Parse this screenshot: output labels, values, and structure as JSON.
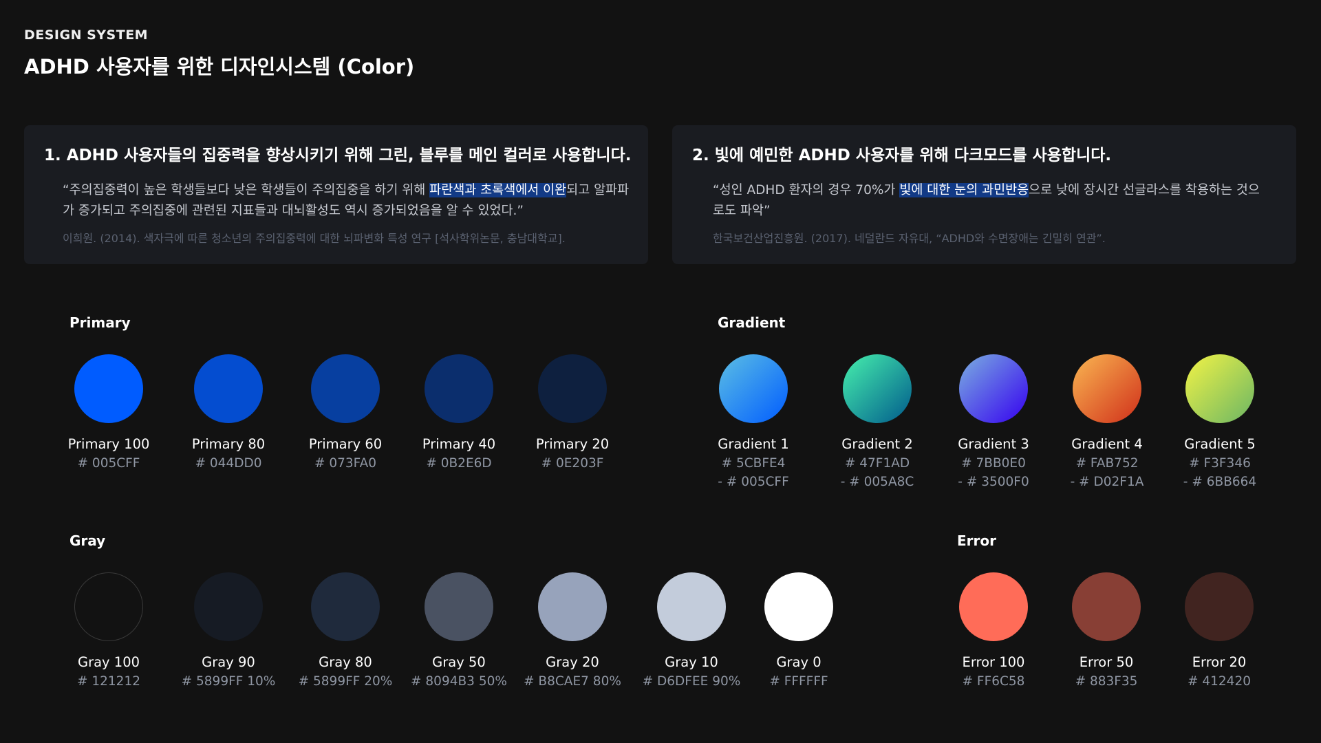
{
  "header": {
    "eyebrow": "DESIGN SYSTEM",
    "title": "ADHD 사용자를 위한 디자인시스템 (Color)"
  },
  "principles": [
    {
      "title": "1. ADHD 사용자들의 집중력을 향상시키기 위해 그린, 블루를 메인 컬러로 사용합니다.",
      "quote_before": "“주의집중력이 높은 학생들보다 낮은 학생들이 주의집중을 하기 위해 ",
      "quote_highlight": "파란색과 초록색에서 이완",
      "quote_after": "되고 알파파가 증가되고 주의집중에 관련된 지표들과 대뇌활성도 역시 증가되었음을 알 수 있었다.”",
      "source": "이희원. (2014). 색자극에 따른 청소년의 주의집중력에 대한 뇌파변화 특성 연구 [석사학위논문, 충남대학교]."
    },
    {
      "title": "2. 빛에 예민한 ADHD 사용자를 위해 다크모드를 사용합니다.",
      "quote_before": "“성인 ADHD 환자의 경우 70%가 ",
      "quote_highlight": "빛에 대한 눈의 과민반응",
      "quote_after": "으로 낮에 장시간 선글라스를 착용하는 것으로도 파악”",
      "source": "한국보건산업진흥원. (2017). 네덜란드 자유대, “ADHD와 수면장애는 긴밀히 연관”."
    }
  ],
  "primary": {
    "label": "Primary",
    "swatches": [
      {
        "name": "Primary 100",
        "hex": "# 005CFF",
        "color": "#005CFF"
      },
      {
        "name": "Primary 80",
        "hex": "# 044DD0",
        "color": "#044DD0"
      },
      {
        "name": "Primary 60",
        "hex": "# 073FA0",
        "color": "#073FA0"
      },
      {
        "name": "Primary 40",
        "hex": "# 0B2E6D",
        "color": "#0B2E6D"
      },
      {
        "name": "Primary 20",
        "hex": "# 0E203F",
        "color": "#0E203F"
      }
    ]
  },
  "gradient": {
    "label": "Gradient",
    "swatches": [
      {
        "name": "Gradient 1",
        "hex": "# 5CBFE4",
        "hex2": "- # 005CFF",
        "from": "#5CBFE4",
        "to": "#005CFF"
      },
      {
        "name": "Gradient 2",
        "hex": "# 47F1AD",
        "hex2": "- # 005A8C",
        "from": "#47F1AD",
        "to": "#005A8C"
      },
      {
        "name": "Gradient 3",
        "hex": "# 7BB0E0",
        "hex2": "- # 3500F0",
        "from": "#7BB0E0",
        "to": "#3500F0"
      },
      {
        "name": "Gradient 4",
        "hex": "# FAB752",
        "hex2": "- # D02F1A",
        "from": "#FAB752",
        "to": "#D02F1A"
      },
      {
        "name": "Gradient 5",
        "hex": "# F3F346",
        "hex2": "- # 6BB664",
        "from": "#F3F346",
        "to": "#6BB664"
      }
    ]
  },
  "gray": {
    "label": "Gray",
    "swatches": [
      {
        "name": "Gray 100",
        "hex": "# 121212",
        "color": "#121212",
        "border": "#3a3a3a"
      },
      {
        "name": "Gray 90",
        "hex": "# 5899FF 10%",
        "color": "#161b24"
      },
      {
        "name": "Gray 80",
        "hex": "# 5899FF 20%",
        "color": "#1f2a3c"
      },
      {
        "name": "Gray 50",
        "hex": "# 8094B3 50%",
        "color": "#4a5262"
      },
      {
        "name": "Gray 20",
        "hex": "# B8CAE7 80%",
        "color": "#97a3bb"
      },
      {
        "name": "Gray 10",
        "hex": "# D6DFEE 90%",
        "color": "#c3ccdb"
      },
      {
        "name": "Gray 0",
        "hex": "# FFFFFF",
        "color": "#FFFFFF"
      }
    ]
  },
  "error": {
    "label": "Error",
    "swatches": [
      {
        "name": "Error 100",
        "hex": "# FF6C58",
        "color": "#FF6C58"
      },
      {
        "name": "Error 50",
        "hex": "# 883F35",
        "color": "#883F35"
      },
      {
        "name": "Error 20",
        "hex": "# 412420",
        "color": "#412420"
      }
    ]
  }
}
